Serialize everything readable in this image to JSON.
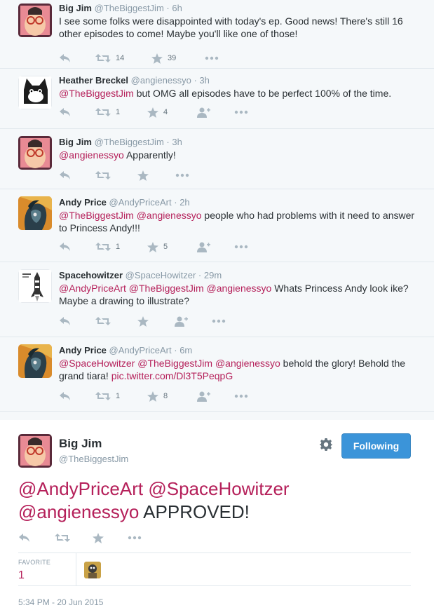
{
  "colors": {
    "mention": "#b5205a",
    "follow_button": "#3b94d9",
    "muted": "#8899a6",
    "icon": "#aab8c2"
  },
  "replies": [
    {
      "name": "Big Jim",
      "handle": "@TheBiggestJim",
      "time": "6h",
      "text_before": "",
      "mentions": [],
      "text": "I see some folks were disappointed with today's ep. Good news! There's still 16 other episodes to come! Maybe you'll like one of those!",
      "retweets": "14",
      "favorites": "39",
      "avatar": "bigjim-avatar"
    },
    {
      "name": "Heather Breckel",
      "handle": "@angienessyo",
      "time": "3h",
      "mentions": "@TheBiggestJim",
      "text": " but OMG all episodes have to be perfect 100% of the time.",
      "retweets": "1",
      "favorites": "4",
      "avatar": "cat-avatar"
    },
    {
      "name": "Big Jim",
      "handle": "@TheBiggestJim",
      "time": "3h",
      "mentions": "@angienessyo",
      "text": " Apparently!",
      "retweets": "",
      "favorites": "",
      "avatar": "bigjim-avatar"
    },
    {
      "name": "Andy Price",
      "handle": "@AndyPriceArt",
      "time": "2h",
      "mentions": "@TheBiggestJim @angienessyo",
      "text": " people who had problems with it need to answer to Princess Andy!!!",
      "retweets": "1",
      "favorites": "5",
      "avatar": "pony-avatar"
    },
    {
      "name": "Spacehowitzer",
      "handle": "@SpaceHowitzer",
      "time": "29m",
      "mentions": "@AndyPriceArt @TheBiggestJim @angienessyo",
      "text": " Whats Princess Andy look ike? Maybe a drawing to illustrate?",
      "retweets": "",
      "favorites": "",
      "avatar": "rocket-avatar"
    },
    {
      "name": "Andy Price",
      "handle": "@AndyPriceArt",
      "time": "6m",
      "mentions": "@SpaceHowitzer @TheBiggestJim @angienessyo",
      "text": " behold the glory! Behold the grand tiara! ",
      "link": "pic.twitter.com/Dl3T5PeqpG",
      "retweets": "1",
      "favorites": "8",
      "avatar": "pony-avatar"
    }
  ],
  "main_tweet": {
    "name": "Big Jim",
    "handle": "@TheBiggestJim",
    "follow_label": "Following",
    "mentions_line1": "@AndyPriceArt @SpaceHowitzer",
    "mentions_line2": "@angienessyo",
    "text": " APPROVED!",
    "favorite_label": "FAVORITE",
    "favorite_count": "1",
    "timestamp": "5:34 PM - 20 Jun 2015"
  }
}
